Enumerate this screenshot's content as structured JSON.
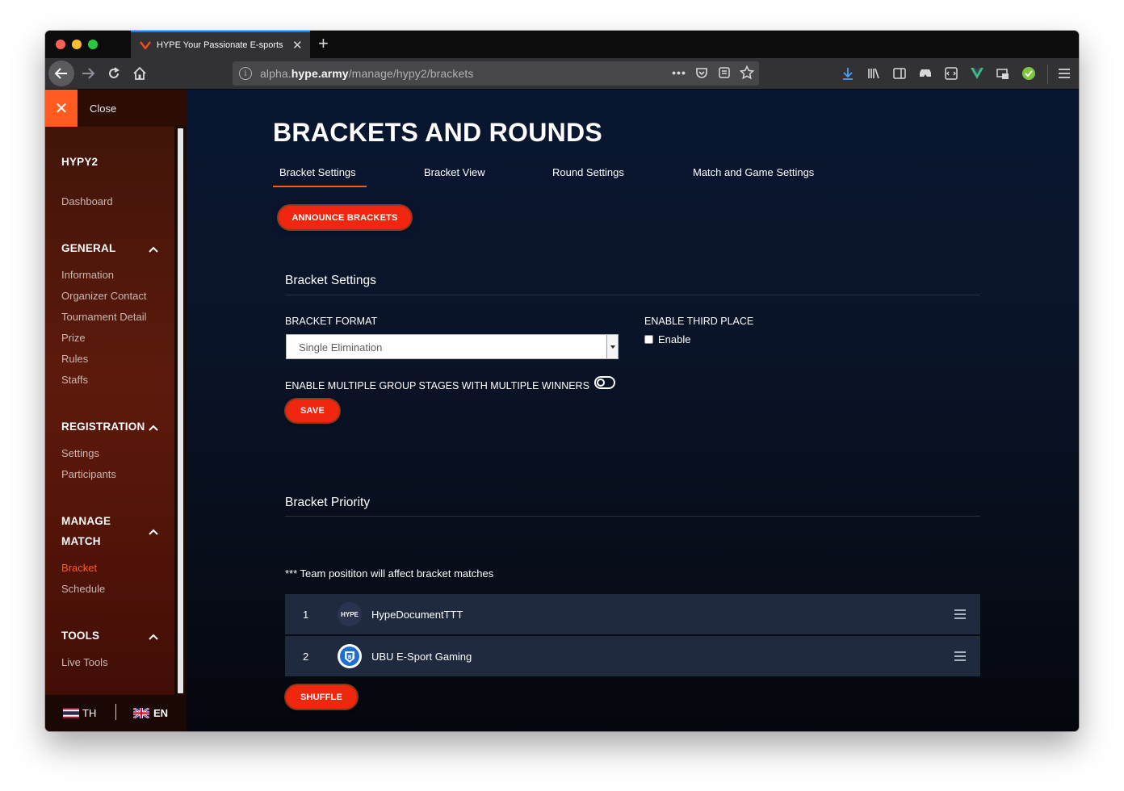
{
  "browser": {
    "tab_title": "HYPE Your Passionate E-sports",
    "url_prefix": "alpha.",
    "url_domain": "hype.army",
    "url_path": "/manage/hypy2/brackets",
    "url_overflow": "•••"
  },
  "sidebar": {
    "close_label": "Close",
    "event_name": "HYPY2",
    "dashboard": "Dashboard",
    "sections": [
      {
        "title": "GENERAL",
        "items": [
          "Information",
          "Organizer Contact",
          "Tournament Detail",
          "Prize",
          "Rules",
          "Staffs"
        ]
      },
      {
        "title": "REGISTRATION",
        "items": [
          "Settings",
          "Participants"
        ]
      },
      {
        "title_line1": "MANAGE",
        "title_line2": "MATCH",
        "items": [
          "Bracket",
          "Schedule"
        ],
        "active": "Bracket"
      },
      {
        "title": "TOOLS",
        "items": [
          "Live Tools"
        ]
      }
    ],
    "lang_th": "TH",
    "lang_en": "EN",
    "active_lang": "EN",
    "accent_color": "#ff5a1f"
  },
  "main": {
    "page_title": "BRACKETS AND ROUNDS",
    "tabs": [
      "Bracket Settings",
      "Bracket View",
      "Round Settings",
      "Match and Game Settings"
    ],
    "active_tab": "Bracket Settings",
    "announce_button": "ANNOUNCE BRACKETS",
    "bracket_settings": {
      "title": "Bracket Settings",
      "format_label": "BRACKET FORMAT",
      "format_value": "Single Elimination",
      "third_place_label": "ENABLE THIRD PLACE",
      "third_place_checkbox_label": "Enable",
      "third_place_checked": false,
      "multi_group_label": "ENABLE MULTIPLE GROUP STAGES WITH MULTIPLE WINNERS",
      "multi_group_enabled": false,
      "save_button": "SAVE"
    },
    "bracket_priority": {
      "title": "Bracket Priority",
      "note": "*** Team posititon will affect bracket matches",
      "teams": [
        {
          "rank": "1",
          "name": "HypeDocumentTTT",
          "logo": "HYPE"
        },
        {
          "rank": "2",
          "name": "UBU E-Sport Gaming",
          "logo": "ubu-shield-icon"
        }
      ],
      "shuffle_button": "SHUFFLE"
    }
  }
}
